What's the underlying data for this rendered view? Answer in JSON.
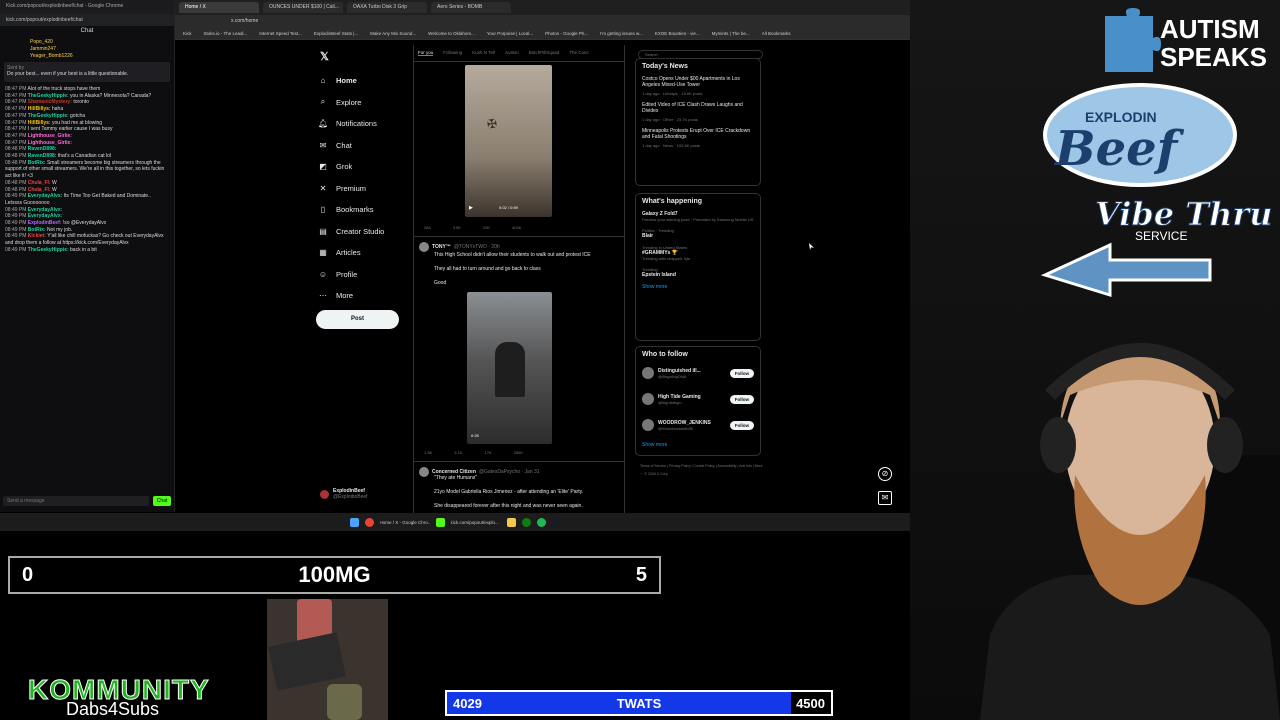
{
  "chat": {
    "sysbar": "Kick.com/popout/explodinbeef/chat - Google Chrome",
    "url": "kick.com/popout/explodinbeef/chat",
    "title": "Chat",
    "leaders": [
      "Popo_420",
      "Jammin247",
      "Yeager_Bomb1226"
    ],
    "pinned_by": "Sent by",
    "pinned_text": "Do your best... even if your best is a little questionable.",
    "messages": [
      {
        "t": "08:47 PM",
        "u": "",
        "c": "#e44",
        "m": "Alot of the truck stops have them"
      },
      {
        "t": "08:47 PM",
        "u": "TheGeekyHippie:",
        "c": "#1dd1a1",
        "m": "you in Alaska? Minnesota? Canada?"
      },
      {
        "t": "08:47 PM",
        "u": "ShamanicMystery:",
        "c": "#c0392b",
        "m": "toronto"
      },
      {
        "t": "08:47 PM",
        "u": "HillBillys:",
        "c": "#f1c40f",
        "m": "haha"
      },
      {
        "t": "08:47 PM",
        "u": "TheGeekyHippie:",
        "c": "#1dd1a1",
        "m": "gotcha"
      },
      {
        "t": "08:47 PM",
        "u": "HillBillys:",
        "c": "#f1c40f",
        "m": "you had me at blowing"
      },
      {
        "t": "08:47 PM",
        "u": "",
        "c": "#e44",
        "m": "I sent Tammy earlier cause I was busy"
      },
      {
        "t": "08:47 PM",
        "u": "Lighthouse_Girlie:",
        "c": "#ff6bd6",
        "m": ""
      },
      {
        "t": "08:47 PM",
        "u": "Lighthouse_Girlie:",
        "c": "#ff6bd6",
        "m": ""
      },
      {
        "t": "08:48 PM",
        "u": "RavenD898:",
        "c": "#1dd1a1",
        "m": ""
      },
      {
        "t": "08:48 PM",
        "u": "RavenD898:",
        "c": "#1dd1a1",
        "m": "that's a Canadian cat lol"
      },
      {
        "t": "08:48 PM",
        "u": "BotRix:",
        "c": "#1dd1a1",
        "m": "Small streamers become big streamers through the support of other small streamers. We're all in this together, so lets fuckin act like it! <3"
      },
      {
        "t": "08:48 PM",
        "u": "Chula_Fl:",
        "c": "#e44",
        "m": "W"
      },
      {
        "t": "08:48 PM",
        "u": "Chula_Fl:",
        "c": "#e44",
        "m": "W"
      },
      {
        "t": "08:49 PM",
        "u": "EverydayAlvx:",
        "c": "#1dd1a1",
        "m": "Its Time Too Get Baked and Dominate.. Letssss Goooooooo"
      },
      {
        "t": "08:49 PM",
        "u": "EverydayAlvx:",
        "c": "#1dd1a1",
        "m": ""
      },
      {
        "t": "08:49 PM",
        "u": "EverydayAlvx:",
        "c": "#1dd1a1",
        "m": ""
      },
      {
        "t": "08:49 PM",
        "u": "ExplodinBeef:",
        "c": "#b36bff",
        "m": "!so @EverydayAlvx"
      },
      {
        "t": "08:49 PM",
        "u": "BotRix:",
        "c": "#1dd1a1",
        "m": "Not my job."
      },
      {
        "t": "08:49 PM",
        "u": "Kickiet:",
        "c": "#e44",
        "m": "Y'all like chill mofuckas? Go check out EverydayAlvx and drop them a follow at https://kick.com/EverydayAlvx"
      },
      {
        "t": "08:49 PM",
        "u": "TheGeekyHippie:",
        "c": "#1dd1a1",
        "m": "back in a bit"
      }
    ],
    "input_placeholder": "Send a message",
    "send_label": "Chat"
  },
  "browser": {
    "tabs": [
      "Home / X",
      "OUNCES UNDER $100 | Cali...",
      "OAXA Turbo Disk 3 Grip",
      "Aero Series - BOMB"
    ],
    "active_tab": 0,
    "url": "x.com/home",
    "bookmarks": [
      "Kick",
      "Stoks.io - The Leadi...",
      "Internet Speed Test...",
      "ExplodinBeef Stats |...",
      "Make Any Mix Sound...",
      "Welcome to Oklahom...",
      "Your Porpoise | Local...",
      "Photos - Google Ph...",
      "I'm getting issues w...",
      "KXOE Bounties - vie...",
      "Mymints | The be...",
      "All Bookmarks"
    ]
  },
  "x": {
    "nav": [
      {
        "label": "Home",
        "icon": "⌂",
        "name": "home"
      },
      {
        "label": "Explore",
        "icon": "⌕",
        "name": "explore"
      },
      {
        "label": "Notifications",
        "icon": "🔔︎",
        "name": "notifications"
      },
      {
        "label": "Chat",
        "icon": "✉",
        "name": "chat"
      },
      {
        "label": "Grok",
        "icon": "◩",
        "name": "grok"
      },
      {
        "label": "Premium",
        "icon": "✕",
        "name": "premium"
      },
      {
        "label": "Bookmarks",
        "icon": "▯",
        "name": "bookmarks"
      },
      {
        "label": "Creator Studio",
        "icon": "▤",
        "name": "creator-studio"
      },
      {
        "label": "Articles",
        "icon": "▦",
        "name": "articles"
      },
      {
        "label": "Profile",
        "icon": "☺",
        "name": "profile"
      },
      {
        "label": "More",
        "icon": "⋯",
        "name": "more"
      }
    ],
    "post_label": "Post",
    "account_name": "ExplodinBeef",
    "account_handle": "@ExplodinBeef",
    "feed_tabs": [
      "For you",
      "Following",
      "Kush N Tell",
      "Autism",
      "BotchPillSquad",
      "The Conc"
    ],
    "tweet1": {
      "video_time": "0:02 / 0:59",
      "stats": [
        "284",
        "3.5K",
        "10K",
        "404K"
      ]
    },
    "tweet2": {
      "author": "TONY™",
      "handle": "@TONYxTWO · 20h",
      "text": "This High School didn't allow their students to walk out and protest ICE",
      "text2": "They all had to turn around and go back to class",
      "text3": "Good",
      "video_time": "0:25",
      "stats": [
        "1.5K",
        "3.1K",
        "17K",
        "250K"
      ]
    },
    "tweet3": {
      "author": "Concerned Citizen",
      "handle": "@GatesDaPsycho · Jan 31",
      "text": "\"They ate Humans\"",
      "text2": "21yo Model Gabriella Rios Jimenez - after attending an 'Elite' Party.",
      "text3": "She disappeared forever after this night and was never seen again."
    },
    "search_placeholder": "Search",
    "news_title": "Today's News",
    "news": [
      {
        "h": "Costco Opens Under $00 Apartments in Los Angeles Mixed-Use Tower",
        "m": "1 day ago · Lifestyle · 15.6K posts"
      },
      {
        "h": "Edited Video of ICE Clash Draws Laughs and Divides",
        "m": "1 day ago · Other · 23.7K posts"
      },
      {
        "h": "Minneapolis Protests Erupt Over ICE Crackdown and Fatal Shootings",
        "m": "1 day ago · News · 153.5K posts"
      }
    ],
    "happening_title": "What's happening",
    "trends": [
      {
        "cat": "",
        "topic": "Galaxy Z Fold7",
        "sub": "Preview your winning pose · Promoted by Samsung Mobile US"
      },
      {
        "cat": "Politics · Trending",
        "topic": "Blair",
        "sub": ""
      },
      {
        "cat": "Trending in United States",
        "topic": "#GRAMMYs 🏆",
        "sub": "Trending with chappell, fyle"
      },
      {
        "cat": "Trending",
        "topic": "Epstein Island",
        "sub": ""
      }
    ],
    "show_more": "Show more",
    "who_title": "Who to follow",
    "who": [
      {
        "name": "Distinguished ill...",
        "handle": "@IllegalInyDNA"
      },
      {
        "name": "High Tide Gaming",
        "handle": "@hightidegm"
      },
      {
        "name": "WOODROW_JENKINS",
        "handle": "@Woodrowsmith95"
      }
    ],
    "follow_label": "Follow",
    "footer": "Terms of Service | Privacy Policy | Cookie Policy | Accessibility | Ads info | More ··· © 2026 X Corp."
  },
  "taskbar": [
    "Home / X - Google Chro...",
    "kick.com/popout/explo..."
  ],
  "overlay": {
    "score_left": "0",
    "score_center": "100MG",
    "score_right": "5",
    "goal_current": "4029",
    "goal_label": "TWATS",
    "goal_target": "4500",
    "goal_fraction": 0.895,
    "kommunity_big": "KOMMUNITY",
    "kommunity_small": "Dabs4Subs",
    "autism_line1": "AUTISM",
    "autism_line2": "SPEAKS",
    "beef_line1": "EXPLODIN",
    "beef_line2": "Beef",
    "beef_line3": "Vibe Thru",
    "beef_line4": "SERVICE"
  }
}
